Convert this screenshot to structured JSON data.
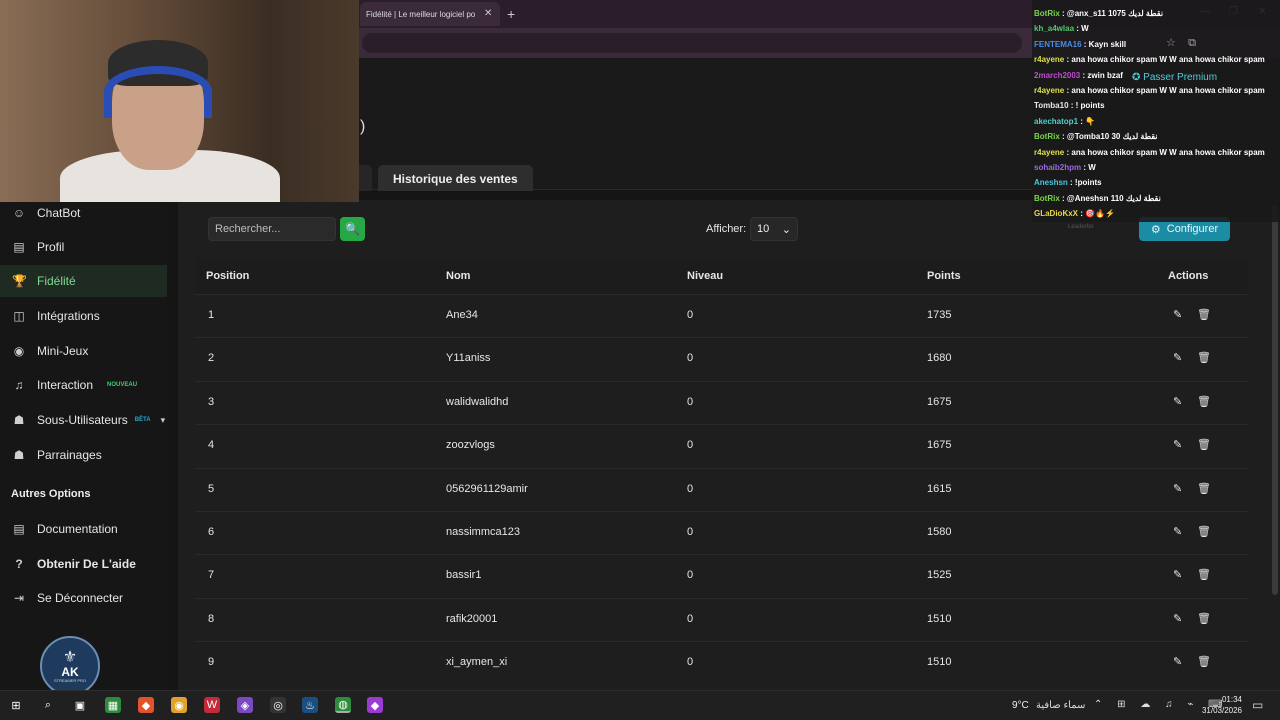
{
  "browser": {
    "tab_title": "Fidélité | Le meilleur logiciel po",
    "tab_close": "✕",
    "new_tab": "+",
    "window_controls": [
      "—",
      "❐",
      "✕"
    ]
  },
  "header": {
    "glyph": ")",
    "tab_sales": "Historique des ventes"
  },
  "sidebar": {
    "items": [
      {
        "label": "ChatBot",
        "icon": "robot-icon",
        "glyph": "☺"
      },
      {
        "label": "Profil",
        "icon": "profile-card-icon",
        "glyph": "▤"
      },
      {
        "label": "Fidélité",
        "icon": "trophy-icon",
        "glyph": "🏆"
      },
      {
        "label": "Intégrations",
        "icon": "integrations-icon",
        "glyph": "◫"
      },
      {
        "label": "Mini-Jeux",
        "icon": "gamepad-icon",
        "glyph": "◉"
      },
      {
        "label": "Interaction",
        "icon": "music-note-icon",
        "glyph": "♫",
        "badge": "NOUVEAU"
      },
      {
        "label": "Sous-Utilisateurs",
        "icon": "users-icon",
        "glyph": "☗",
        "badge": "BÊTA",
        "chevron": "▾"
      },
      {
        "label": "Parrainages",
        "icon": "referral-icon",
        "glyph": "☗"
      }
    ],
    "section_title": "Autres Options",
    "other_items": [
      {
        "label": "Documentation",
        "icon": "document-icon",
        "glyph": "▤"
      },
      {
        "label": "Obtenir De L'aide",
        "icon": "help-icon",
        "glyph": "?"
      },
      {
        "label": "Se Déconnecter",
        "icon": "logout-icon",
        "glyph": "⇥"
      }
    ],
    "logo": {
      "mono": "AK",
      "sub": "STREAMER PRO"
    }
  },
  "toolbar": {
    "search_placeholder": "Rechercher...",
    "search_icon": "🔍",
    "show_label": "Afficher:",
    "show_value": "10",
    "show_chevron": "⌄",
    "configure_label": "Configurer",
    "configure_icon": "⚙",
    "faint_text": "Leaderbo"
  },
  "table": {
    "headers": {
      "position": "Position",
      "nom": "Nom",
      "niveau": "Niveau",
      "points": "Points",
      "actions": "Actions"
    },
    "rows": [
      {
        "position": "1",
        "nom": "Ane34",
        "niveau": "0",
        "points": "1735"
      },
      {
        "position": "2",
        "nom": "Y11aniss",
        "niveau": "0",
        "points": "1680"
      },
      {
        "position": "3",
        "nom": "walidwalidhd",
        "niveau": "0",
        "points": "1675"
      },
      {
        "position": "4",
        "nom": "zoozvlogs",
        "niveau": "0",
        "points": "1675"
      },
      {
        "position": "5",
        "nom": "0562961129amir",
        "niveau": "0",
        "points": "1615"
      },
      {
        "position": "6",
        "nom": "nassimmca123",
        "niveau": "0",
        "points": "1580"
      },
      {
        "position": "7",
        "nom": "bassir1",
        "niveau": "0",
        "points": "1525"
      },
      {
        "position": "8",
        "nom": "rafik20001",
        "niveau": "0",
        "points": "1510"
      },
      {
        "position": "9",
        "nom": "xi_aymen_xi",
        "niveau": "0",
        "points": "1510"
      }
    ],
    "edit_icon": "✎",
    "delete_icon": "🗑"
  },
  "chat": {
    "premium": "✪ Passer Premium",
    "messages": [
      {
        "user": "BotRix",
        "color": "#7ad44c",
        "text": ": @anx_s11 1075 نقطة لديك",
        "mod": true
      },
      {
        "user": "kh_a4wlaa",
        "color": "#4ec86e",
        "text": ": W"
      },
      {
        "user": "FENTEMA16",
        "color": "#4a8ce8",
        "text": ": Kayn skill"
      },
      {
        "user": "r4ayene",
        "color": "#e0e04a",
        "text": ": ana howa chikor spam W W ana howa chikor spam"
      },
      {
        "user": "2march2003",
        "color": "#c24ad4",
        "text": ": zwin bzaf"
      },
      {
        "user": "r4ayene",
        "color": "#e0e04a",
        "text": ": ana howa chikor spam W W ana howa chikor spam"
      },
      {
        "user": "Tomba10",
        "color": "#e8e8e8",
        "text": ": ! points"
      },
      {
        "user": "akechatop1",
        "color": "#4ad4c8",
        "text": ": 👇"
      },
      {
        "user": "BotRix",
        "color": "#7ad44c",
        "text": ": @Tomba10 30 نقطة لديك",
        "mod": true
      },
      {
        "user": "r4ayene",
        "color": "#e0e04a",
        "text": ": ana howa chikor spam W W ana howa chikor spam"
      },
      {
        "user": "sohaib2hpm",
        "color": "#9a6ae0",
        "text": ": W"
      },
      {
        "user": "Aneshsn",
        "color": "#4ac8e0",
        "text": ": !points"
      },
      {
        "user": "BotRix",
        "color": "#7ad44c",
        "text": ": @Aneshsn 110 نقطة لديك",
        "mod": true
      },
      {
        "user": "GLaDioKxX",
        "color": "#e8d84a",
        "text": ": 🎯🔥⚡"
      }
    ]
  },
  "taskbar": {
    "weather_temp": "9°C",
    "weather_text": "سماء صافية",
    "time": "01:34",
    "date": "31/03/2026",
    "tray": "⌃ ⊞ ☁ ♫ ⌁ ⌨"
  },
  "colors": {
    "accent_green": "#27a846",
    "config_teal": "#1b8ca3",
    "active_nav": "#7fdc8f"
  }
}
